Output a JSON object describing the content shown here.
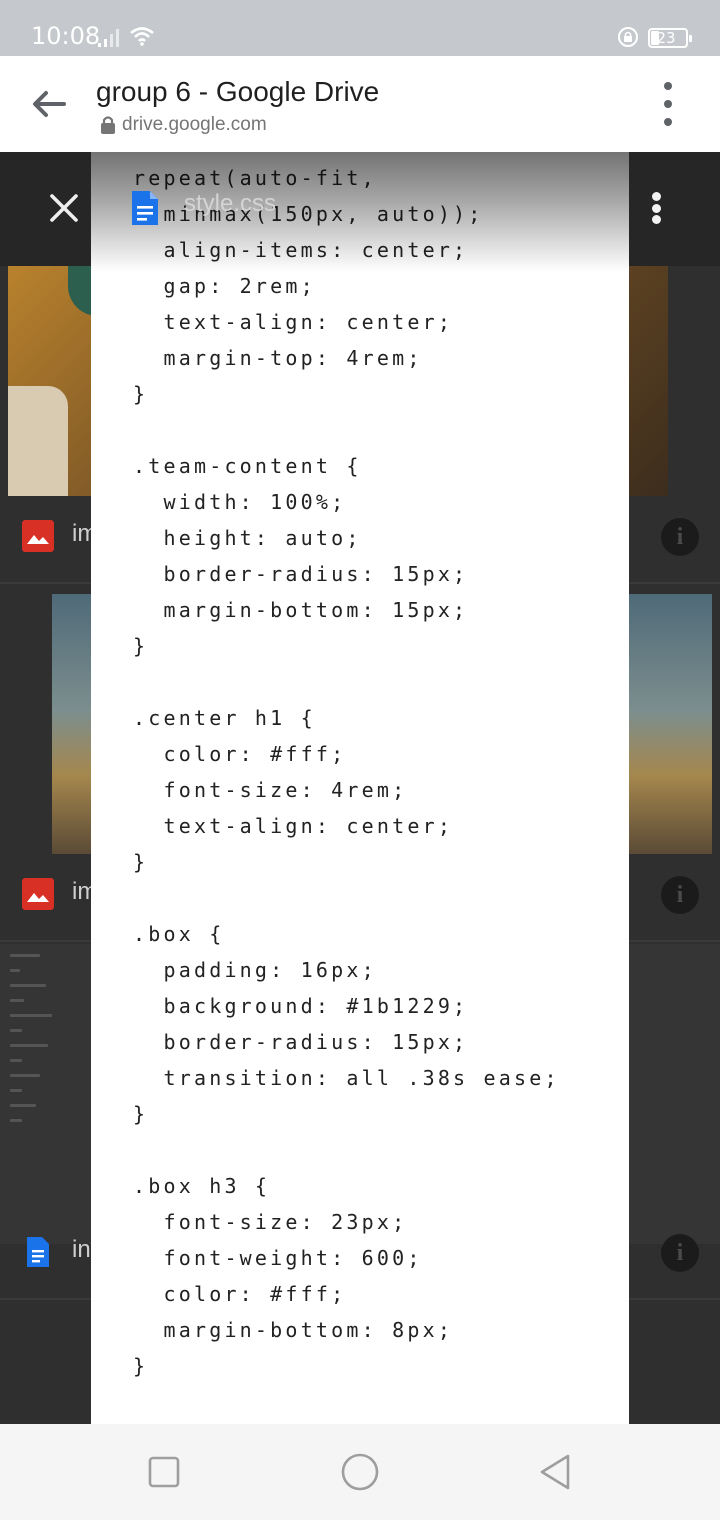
{
  "status_bar": {
    "time": "10:08",
    "battery_level": "23",
    "icons": [
      "signal-icon",
      "wifi-icon",
      "screen-lock-icon",
      "battery-icon"
    ]
  },
  "browser": {
    "title": "group 6 - Google Drive",
    "url": "drive.google.com",
    "icons": [
      "back-arrow-icon",
      "lock-icon",
      "more-vert-icon"
    ]
  },
  "drive_list": {
    "items": [
      {
        "name": "im",
        "icon": "image-file-icon",
        "color": "#d93025"
      },
      {
        "name": "im",
        "icon": "image-file-icon",
        "color": "#d93025"
      },
      {
        "name": "in",
        "icon": "docs-file-icon",
        "color": "#1a73e8"
      }
    ]
  },
  "viewer": {
    "filename": "style.css",
    "icons": [
      "close-icon",
      "docs-file-icon",
      "download-icon",
      "more-vert-icon"
    ]
  },
  "code_lines": [
    "repeat(auto-fit,",
    "  minmax(150px, auto));",
    "  align-items: center;",
    "  gap: 2rem;",
    "  text-align: center;",
    "  margin-top: 4rem;",
    "}",
    "",
    ".team-content {",
    "  width: 100%;",
    "  height: auto;",
    "  border-radius: 15px;",
    "  margin-bottom: 15px;",
    "}",
    "",
    ".center h1 {",
    "  color: #fff;",
    "  font-size: 4rem;",
    "  text-align: center;",
    "}",
    "",
    ".box {",
    "  padding: 16px;",
    "  background: #1b1229;",
    "  border-radius: 15px;",
    "  transition: all .38s ease;",
    "}",
    "",
    ".box h3 {",
    "  font-size: 23px;",
    "  font-weight: 600;",
    "  color: #fff;",
    "  margin-bottom: 8px;",
    "}"
  ],
  "nav_bar": {
    "icons": [
      "recents-square-icon",
      "home-circle-icon",
      "back-triangle-icon"
    ]
  }
}
